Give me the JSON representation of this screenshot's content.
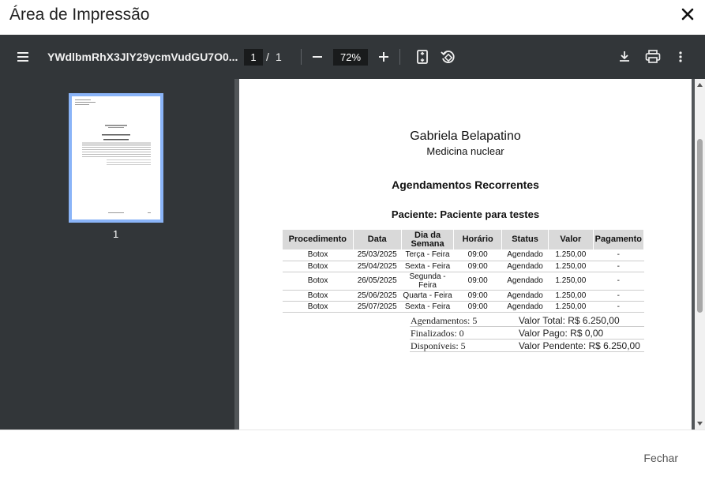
{
  "modal": {
    "title": "Área de Impressão",
    "close_label": "×"
  },
  "toolbar": {
    "doc_title": "YWdlbmRhX3JlY29ycmVudGU7O0...",
    "page_current": "1",
    "page_separator": "/",
    "page_total": "1",
    "zoom_value": "72%"
  },
  "sidebar": {
    "thumb_number": "1"
  },
  "document": {
    "doctor_name": "Gabriela Belapatino",
    "specialty": "Medicina nuclear",
    "report_title": "Agendamentos Recorrentes",
    "patient_line": "Paciente: Paciente para testes",
    "columns": [
      "Procedimento",
      "Data",
      "Dia da Semana",
      "Horário",
      "Status",
      "Valor",
      "Pagamento"
    ],
    "rows": [
      [
        "Botox",
        "25/03/2025",
        "Terça - Feira",
        "09:00",
        "Agendado",
        "1.250,00",
        "-"
      ],
      [
        "Botox",
        "25/04/2025",
        "Sexta - Feira",
        "09:00",
        "Agendado",
        "1.250,00",
        "-"
      ],
      [
        "Botox",
        "26/05/2025",
        "Segunda - Feira",
        "09:00",
        "Agendado",
        "1.250,00",
        "-"
      ],
      [
        "Botox",
        "25/06/2025",
        "Quarta - Feira",
        "09:00",
        "Agendado",
        "1.250,00",
        "-"
      ],
      [
        "Botox",
        "25/07/2025",
        "Sexta - Feira",
        "09:00",
        "Agendado",
        "1.250,00",
        "-"
      ]
    ],
    "summary": [
      [
        "Agendamentos: 5",
        "Valor Total: R$ 6.250,00"
      ],
      [
        "Finalizados: 0",
        "Valor Pago: R$ 0,00"
      ],
      [
        "Disponíveis: 5",
        "Valor Pendente: R$ 6.250,00"
      ]
    ]
  },
  "footer": {
    "close_button": "Fechar"
  },
  "icons": {
    "menu": "menu-icon",
    "zoom_out": "minus-icon",
    "zoom_in": "plus-icon",
    "fit_page": "fit-page-icon",
    "rotate": "rotate-icon",
    "download": "download-icon",
    "print": "print-icon",
    "more": "more-vert-icon",
    "close": "close-icon"
  },
  "colors": {
    "toolbar": "#323639",
    "viewer": "#525659",
    "thumb_border": "#8ab4f8",
    "table_header": "#d9d9d9"
  }
}
